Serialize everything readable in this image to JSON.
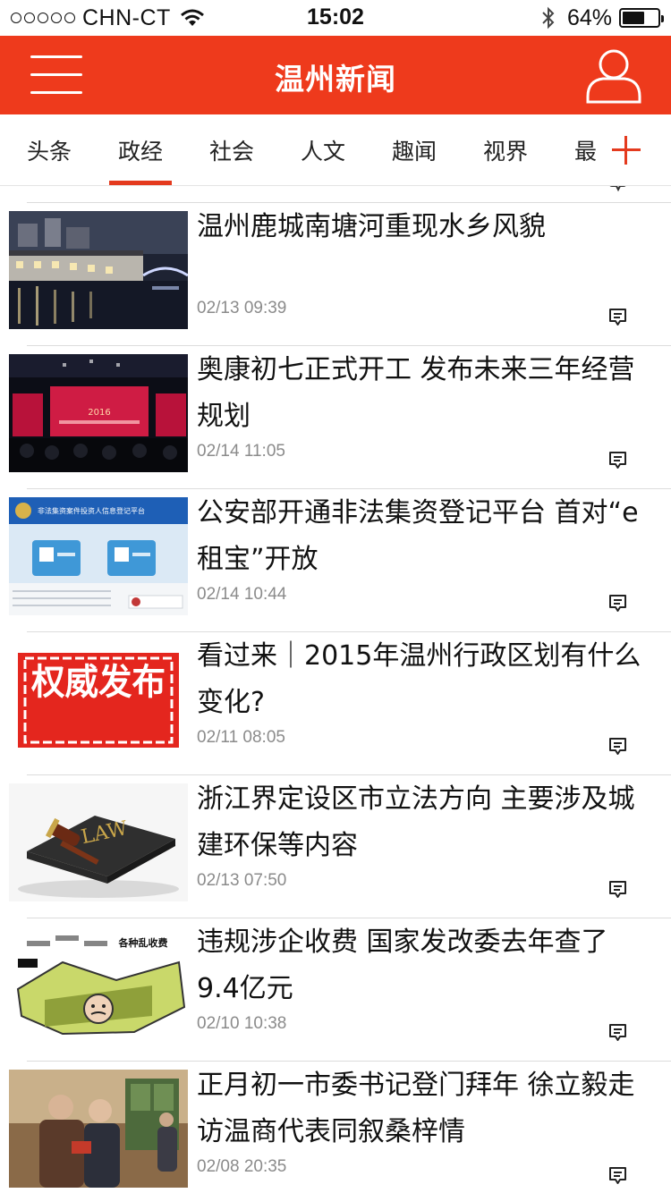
{
  "status_bar": {
    "carrier": "CHN-CT",
    "time": "15:02",
    "battery_text": "64%",
    "battery_level": 0.64
  },
  "header": {
    "title": "温州新闻"
  },
  "tabs": [
    {
      "label": "头条",
      "active": false
    },
    {
      "label": "政经",
      "active": true
    },
    {
      "label": "社会",
      "active": false
    },
    {
      "label": "人文",
      "active": false
    },
    {
      "label": "趣闻",
      "active": false
    },
    {
      "label": "视界",
      "active": false
    },
    {
      "label": "最",
      "active": false
    }
  ],
  "colors": {
    "brand": "#ee3a1c",
    "tab_indicator": "#e43a1e",
    "time_text": "#8b8b8b"
  },
  "news": [
    {
      "title": "温州鹿城南塘河重现水乡风貌",
      "time": "02/13 09:39",
      "thumb": "night-river-photo",
      "thumb_text": ""
    },
    {
      "title": "奥康初七正式开工 发布未来三年经营规划",
      "time": "02/14 11:05",
      "thumb": "conference-stage-photo",
      "thumb_text": "2016"
    },
    {
      "title": "公安部开通非法集资登记平台 首对“e租宝”开放",
      "time": "02/14 10:44",
      "thumb": "registration-platform-screenshot",
      "thumb_text": "非法集资案件投资人信息登记平台"
    },
    {
      "title": "看过来｜2015年温州行政区划有什么变化?",
      "time": "02/11 08:05",
      "thumb": "authority-release-seal",
      "thumb_text": "权威发布"
    },
    {
      "title": "浙江界定设区市立法方向 主要涉及城建环保等内容",
      "time": "02/13 07:50",
      "thumb": "law-book-gavel",
      "thumb_text": "LAW"
    },
    {
      "title": "违规涉企收费 国家发改委去年查了9.4亿元",
      "time": "02/10 10:38",
      "thumb": "fees-cartoon",
      "thumb_text": "各种乱收费"
    },
    {
      "title": "正月初一市委书记登门拜年 徐立毅走访温商代表同叙桑梓情",
      "time": "02/08 20:35",
      "thumb": "home-visit-photo",
      "thumb_text": ""
    }
  ]
}
